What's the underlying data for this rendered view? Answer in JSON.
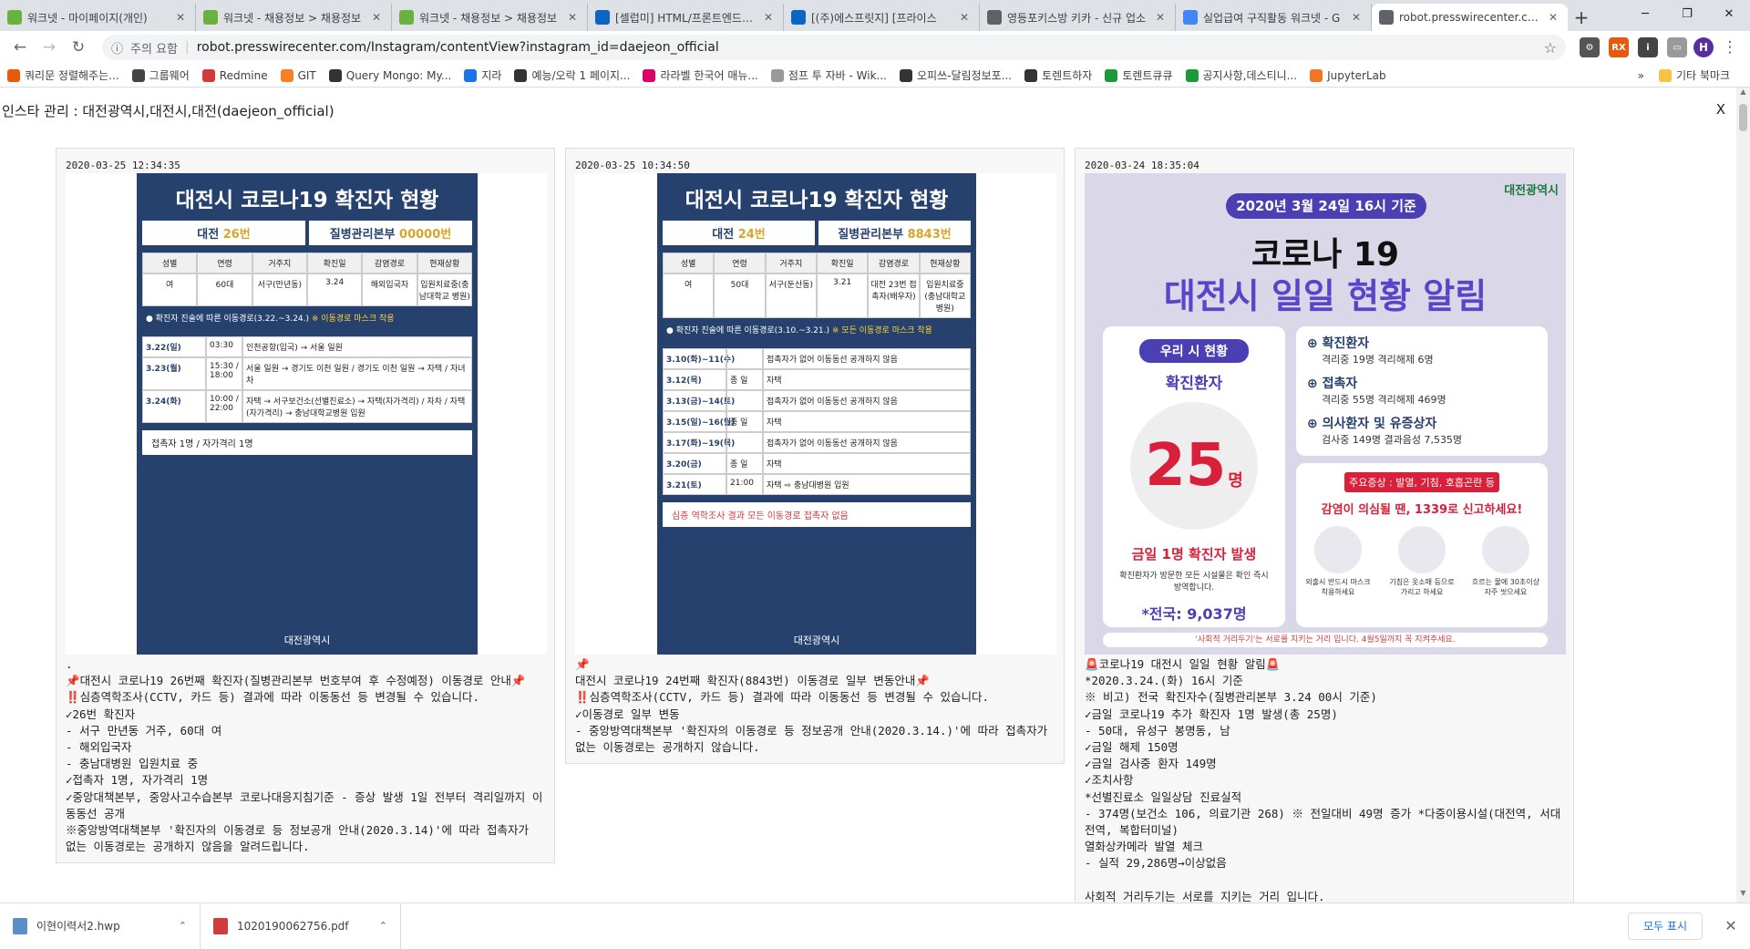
{
  "tabs": [
    {
      "title": "워크넷 - 마이페이지(개인)",
      "icon": "worknet-icon",
      "color": "#6bb13f"
    },
    {
      "title": "워크넷 - 채용정보 > 채용정보",
      "icon": "worknet-icon",
      "color": "#6bb13f"
    },
    {
      "title": "워크넷 - 채용정보 > 채용정보",
      "icon": "worknet-icon",
      "color": "#6bb13f"
    },
    {
      "title": "[셀럽미] HTML/프론트엔드 개발자",
      "icon": "linkedin-icon",
      "color": "#0a66c2"
    },
    {
      "title": "[(주)에스프릿지] [프라이스",
      "icon": "linkedin-icon",
      "color": "#0a66c2"
    },
    {
      "title": "영등포키스방 키카 - 신규 업소",
      "icon": "document-icon",
      "color": "#5f6368"
    },
    {
      "title": "실업급여 구직활동 워크넷 - G",
      "icon": "google-icon",
      "color": "#4285f4"
    },
    {
      "title": "robot.presswirecenter.com",
      "icon": "globe-icon",
      "color": "#5f6368"
    }
  ],
  "omnibox": {
    "security": "주의 요함",
    "url": "robot.presswirecenter.com/Instagram/contentView?instagram_id=daejeon_official"
  },
  "bookmarks": [
    "쿼리문 정렬해주는...",
    "그룹웨어",
    "Redmine",
    "GIT",
    "Query Mongo: My...",
    "지라",
    "예능/오락 1 페이지...",
    "라라벨 한국어 매뉴...",
    "점프 투 자바 - Wik...",
    "오피쓰-달림정보포...",
    "토렌트하자",
    "토렌트큐큐",
    "공지사항,데스티니...",
    "JupyterLab"
  ],
  "bookmark_other": "기타 북마크",
  "page": {
    "title": "인스타 관리 : 대전광역시,대전시,대전(daejeon_official)",
    "close": "X"
  },
  "posts": [
    {
      "date": "2020-03-25 12:34:35",
      "poster": {
        "heading": "대전시 코로나19 확진자 현황",
        "left_label": "대전 ",
        "left_num": "26번",
        "right_label": "질병관리본부 ",
        "right_num": "00000번",
        "columns": [
          "성별",
          "연령",
          "거주지",
          "확진일",
          "감염경로",
          "현재상황"
        ],
        "row": [
          "여",
          "60대",
          "서구(만년동)",
          "3.24",
          "해외입국자",
          "입원치료중(충남대학교 병원)"
        ],
        "route_title": "● 확진자 진술에 따른 이동경로(3.22.~3.24.)",
        "route_note": " ※ 이동경로 마스크 착용",
        "routes": [
          {
            "date": "3.22(일)",
            "time": "03:30",
            "desc": "인천공항(입국) → 서울 일원"
          },
          {
            "date": "3.23(월)",
            "time": "15:30 / 18:00",
            "desc": "서울 일원 → 경기도 이천 일원 / 경기도 이천 일원 → 자택 / 자녀차"
          },
          {
            "date": "3.24(화)",
            "time": "10:00 / 22:00",
            "desc": "자택 → 서구보건소(선별진료소) → 자택(자가격리) / 자차 / 자택(자가격리) → 충남대학교병원 입원"
          }
        ],
        "contacts": "접촉자 1명 / 자가격리 1명",
        "footer": "대전광역시"
      },
      "caption": ".\n📌대전시 코로나19 26번째 확진자(질병관리본부 번호부여 후 수정예정) 이동경로 안내📌\n‼️심층역학조사(CCTV, 카드 등) 결과에 따라 이동동선 등 변경될 수 있습니다.\n✓26번 확진자\n- 서구 만년동 거주, 60대 여\n- 해외입국자\n- 충남대병원 입원치료 중\n✓접촉자 1명, 자가격리 1명\n✓중앙대책본부, 중앙사고수습본부 코로나대응지침기준 - 증상 발생 1일 전부터 격리일까지 이동동선 공개\n※중앙방역대책본부 '확진자의 이동경로 등 정보공개 안내(2020.3.14)'에 따라 접촉자가 없는 이동경로는 공개하지 않음을 알려드립니다."
    },
    {
      "date": "2020-03-25 10:34:50",
      "poster": {
        "heading": "대전시 코로나19 확진자 현황",
        "left_label": "대전 ",
        "left_num": "24번",
        "right_label": "질병관리본부 ",
        "right_num": "8843번",
        "columns": [
          "성별",
          "연령",
          "거주지",
          "확진일",
          "감염경로",
          "현재상황"
        ],
        "row": [
          "여",
          "50대",
          "서구(둔산동)",
          "3.21",
          "대전 23번 접촉자(배우자)",
          "입원치료중(충남대학교 병원)"
        ],
        "route_title": "● 확진자 진술에 따른 이동경로(3.10.~3.21.)",
        "route_note": " ※ 모든 이동경로 마스크 착용",
        "routes": [
          {
            "date": "3.10(화)~11(수)",
            "time": "",
            "desc": "접촉자가 없어 이동동선 공개하지 않음"
          },
          {
            "date": "3.12(목)",
            "time": "종 일",
            "desc": "자택"
          },
          {
            "date": "3.13(금)~14(토)",
            "time": "",
            "desc": "접촉자가 없어 이동동선 공개하지 않음"
          },
          {
            "date": "3.15(일)~16(월)",
            "time": "종 일",
            "desc": "자택"
          },
          {
            "date": "3.17(화)~19(목)",
            "time": "",
            "desc": "접촉자가 없어 이동동선 공개하지 않음"
          },
          {
            "date": "3.20(금)",
            "time": "종 일",
            "desc": "자택"
          },
          {
            "date": "3.21(토)",
            "time": "21:00",
            "desc": "자택 ⇨ 충남대병원 입원"
          }
        ],
        "contacts": "심층 역학조사 결과 모든 이동경로 접촉자 없음",
        "footer": "대전광역시"
      },
      "caption": "📌\n대전시 코로나19 24번째 확진자(8843번) 이동경로 일부 변동안내📌\n‼️심층역학조사(CCTV, 카드 등) 결과에 따라 이동동선 등 변경될 수 있습니다.\n✓이동경로 일부 변동\n- 중앙방역대책본부 '확진자의 이동경로 등 정보공개 안내(2020.3.14.)'에 따라 접촉자가 없는 이동경로는 공개하지 않습니다."
    },
    {
      "date": "2020-03-24 18:35:04",
      "poster": {
        "badge": "2020년 3월 24일 16시 기준",
        "logo": "대전광역시",
        "title1": "코로나 19",
        "title2": "대전시 일일 현황 알림",
        "city_status": "우리 시 현황",
        "confirmed_label": "확진환자",
        "confirmed_num": "25",
        "confirmed_unit": "명",
        "today": "금일 1명 확진자 발생",
        "today_sub": "확진환자가 방문한 모든 시설물은 확인 즉시 방역합니다.",
        "national": "*전국: 9,037명",
        "stats": [
          {
            "label": "확진환자",
            "detail": "격리중 19명 격리해제 6명"
          },
          {
            "label": "접촉자",
            "detail": "격리중 55명 격리해제 469명"
          },
          {
            "label": "의사환자 및 유증상자",
            "detail": "검사중 149명 결과음성 7,535명"
          }
        ],
        "symptoms": "주요증상 : 발열, 기침, 호흡곤란 등",
        "call": "감염이 의심될 땐, 1339로 신고하세요!",
        "tips": [
          "외출시 반드시 마스크 착용하세요",
          "기침은 옷소매 등으로 가리고 하세요",
          "흐르는 물에 30초이상 자주 씻으세요"
        ],
        "footer": "'사회적 거리두기'는 서로를 지키는 거리 입니다. 4월5일까지 꼭 지켜주세요."
      },
      "caption": "🚨코로나19 대전시 일일 현황 알림🚨\n*2020.3.24.(화) 16시 기준\n※ 비고) 전국 확진자수(질병관리본부 3.24 00시 기준)\n✓금일 코로나19 추가 확진자 1명 발생(총 25명)\n- 50대, 유성구 봉명동, 남\n✓금일 해제 150명\n✓금일 검사중 환자 149명\n✓조치사항\n*선별진료소 일일상담 진료실적\n- 374명(보건소 106, 의료기관 268) ※ 전일대비 49명 증가 *다중이용시설(대전역, 서대전역, 복합터미널)\n열화상카메라 발열 체크\n- 실적 29,286명→이상없음\n\n사회적 거리두기는 서로를 지키는 거리 입니다."
    }
  ],
  "downloads": [
    {
      "name": "이현이력서2.hwp",
      "icon": "hwp-file-icon"
    },
    {
      "name": "1020190062756.pdf",
      "icon": "pdf-file-icon"
    }
  ],
  "download_show_all": "모두 표시"
}
